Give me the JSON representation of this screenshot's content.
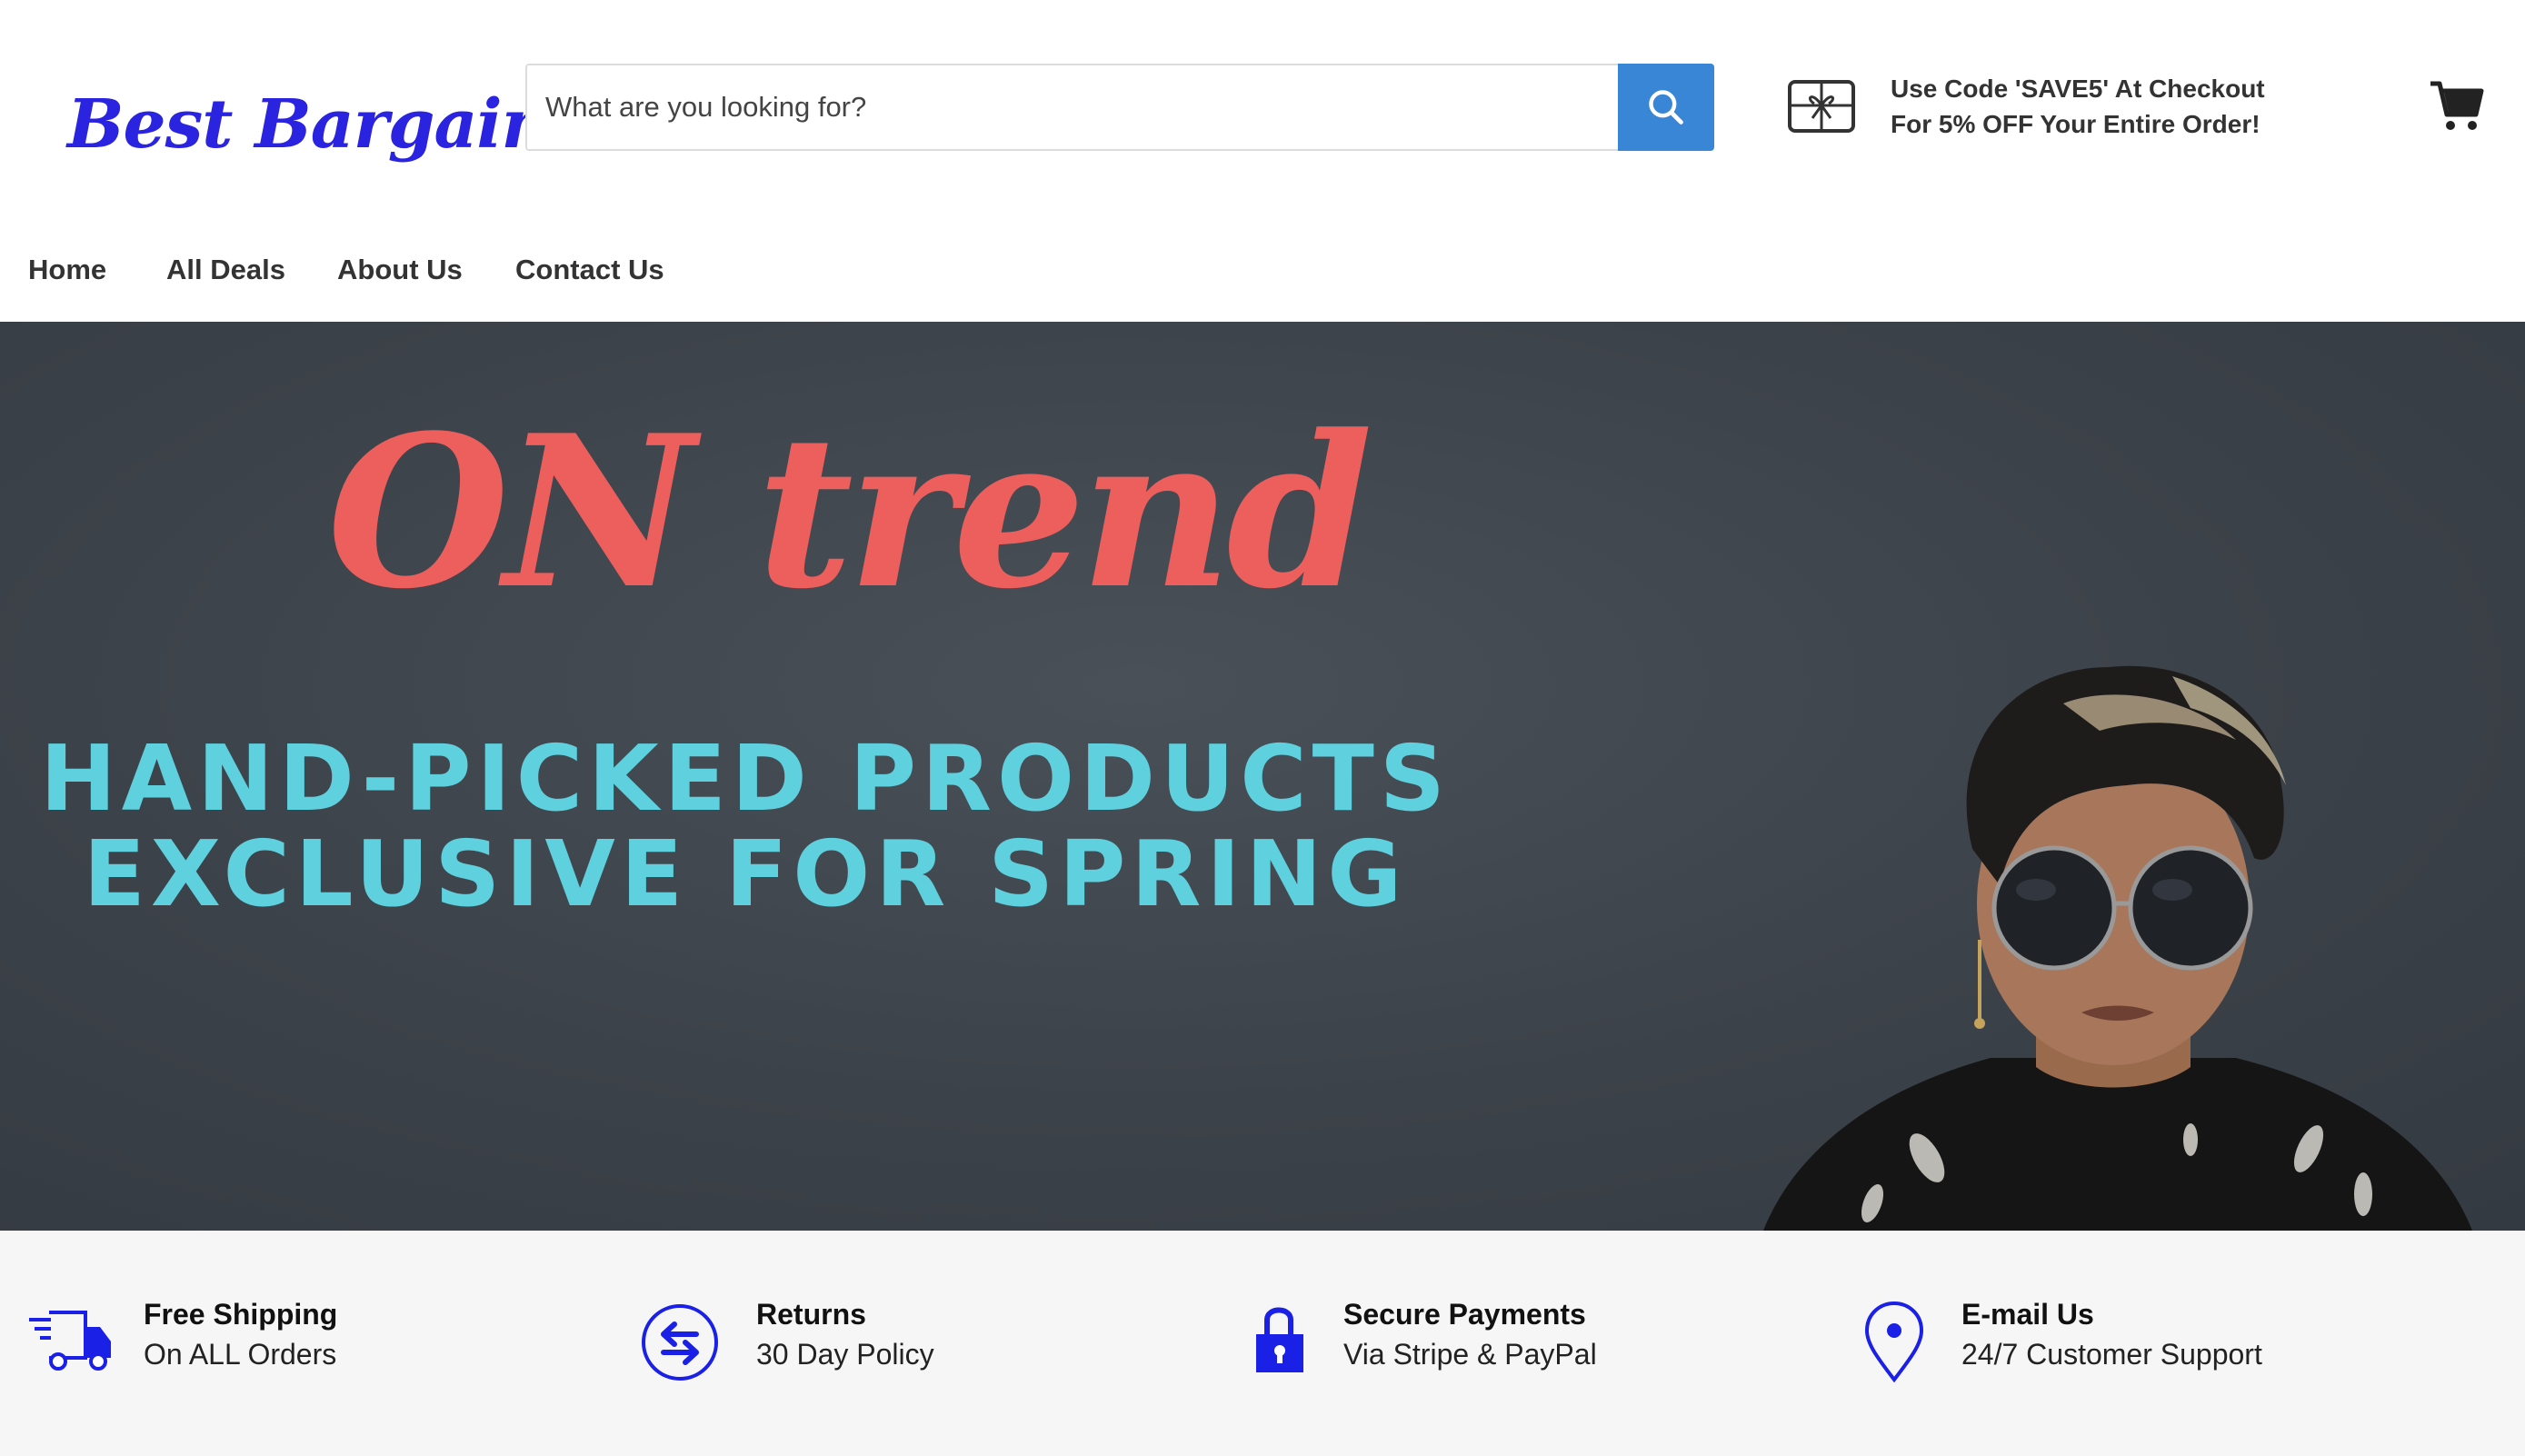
{
  "header": {
    "logo_text": "Best Bargain",
    "search": {
      "placeholder": "What are you looking for?",
      "value": ""
    },
    "promo": {
      "line1": "Use Code 'SAVE5' At Checkout",
      "line2": "For 5% OFF Your Entire Order!"
    }
  },
  "nav": {
    "items": [
      {
        "label": "Home"
      },
      {
        "label": "All Deals"
      },
      {
        "label": "About Us"
      },
      {
        "label": "Contact Us"
      }
    ]
  },
  "hero": {
    "script_text": "ON trend",
    "line1": "HAND-PICKED PRODUCTS",
    "line2": "EXCLUSIVE FOR SPRING"
  },
  "features": [
    {
      "icon": "truck-icon",
      "title": "Free Shipping",
      "subtitle": "On ALL Orders"
    },
    {
      "icon": "returns-icon",
      "title": "Returns",
      "subtitle": "30 Day Policy"
    },
    {
      "icon": "lock-icon",
      "title": "Secure Payments",
      "subtitle": "Via Stripe & PayPal"
    },
    {
      "icon": "location-pin-icon",
      "title": "E-mail Us",
      "subtitle": "24/7 Customer Support"
    }
  ],
  "colors": {
    "brand": "#2a23e0",
    "search_button": "#3a86d6",
    "hero_script": "#ec5f5d",
    "hero_text": "#5fd0de",
    "hero_bg": "#3f454c",
    "feature_icon": "#1a20e6"
  }
}
